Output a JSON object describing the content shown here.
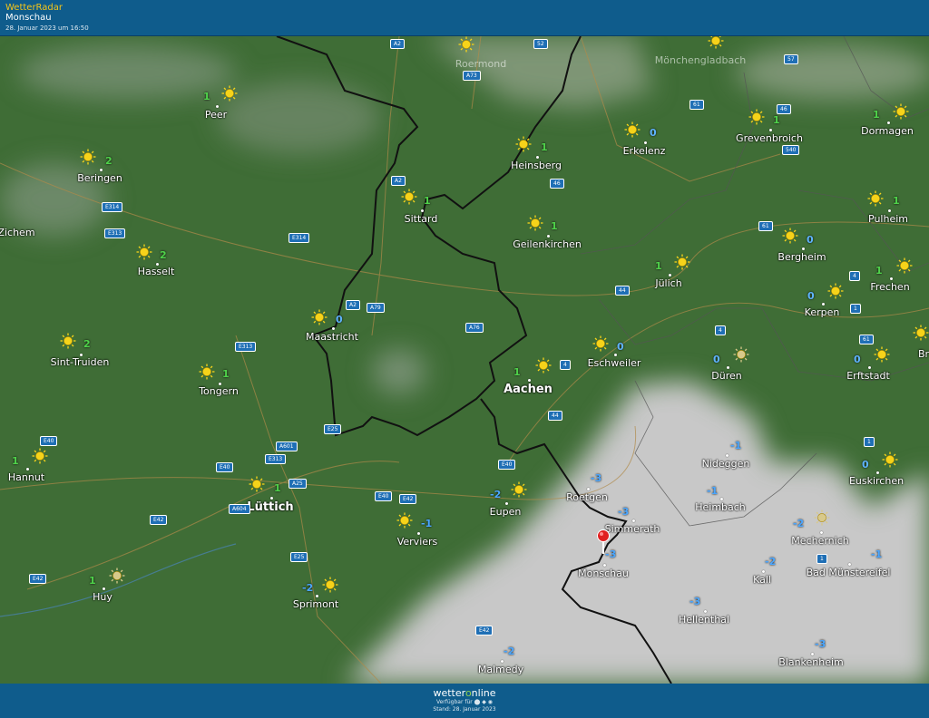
{
  "header": {
    "app_title": "WetterRadar",
    "location": "Monschau",
    "timestamp": "28. Januar 2023 um 16:50"
  },
  "footer": {
    "brand_pre": "wetter",
    "brand_o": "o",
    "brand_post": "nline",
    "available": "Verfügbar für ⬤ ◆ ◉",
    "stand": "Stand: 28. Januar 2023"
  },
  "colors": {
    "header_bg": "#0f5c8c",
    "land": "#3d6a35",
    "cloud": "#c9c9c9",
    "sun": "#f6d31a",
    "positive_temp": "#4fd24a",
    "negative_temp": "#4aa6ff",
    "marker": "#e02020"
  },
  "towns": [
    {
      "name": "Peer",
      "temp": "1",
      "sign": "pos"
    },
    {
      "name": "Beringen",
      "temp": "2",
      "sign": "pos"
    },
    {
      "name": "Zichem",
      "temp": "",
      "sign": "pos"
    },
    {
      "name": "Hasselt",
      "temp": "2",
      "sign": "pos"
    },
    {
      "name": "Sint-Truiden",
      "temp": "2",
      "sign": "pos"
    },
    {
      "name": "Tongern",
      "temp": "1",
      "sign": "pos"
    },
    {
      "name": "Hannut",
      "temp": "1",
      "sign": "pos"
    },
    {
      "name": "Lüttich",
      "temp": "1",
      "sign": "pos"
    },
    {
      "name": "Huy",
      "temp": "1",
      "sign": "pos"
    },
    {
      "name": "Sprimont",
      "temp": "-2",
      "sign": "neg"
    },
    {
      "name": "Verviers",
      "temp": "-1",
      "sign": "neg"
    },
    {
      "name": "Eupen",
      "temp": "-2",
      "sign": "neg"
    },
    {
      "name": "Maastricht",
      "temp": "0",
      "sign": "zero"
    },
    {
      "name": "Sittard",
      "temp": "1",
      "sign": "pos"
    },
    {
      "name": "Heinsberg",
      "temp": "1",
      "sign": "pos"
    },
    {
      "name": "Erkelenz",
      "temp": "0",
      "sign": "zero"
    },
    {
      "name": "Geilenkirchen",
      "temp": "1",
      "sign": "pos"
    },
    {
      "name": "Aachen",
      "temp": "1",
      "sign": "pos"
    },
    {
      "name": "Eschweiler",
      "temp": "0",
      "sign": "zero"
    },
    {
      "name": "Jülich",
      "temp": "1",
      "sign": "pos"
    },
    {
      "name": "Düren",
      "temp": "0",
      "sign": "zero"
    },
    {
      "name": "Grevenbroich",
      "temp": "1",
      "sign": "pos"
    },
    {
      "name": "Dormagen",
      "temp": "1",
      "sign": "pos"
    },
    {
      "name": "Pulheim",
      "temp": "1",
      "sign": "pos"
    },
    {
      "name": "Bergheim",
      "temp": "0",
      "sign": "zero"
    },
    {
      "name": "Frechen",
      "temp": "1",
      "sign": "pos"
    },
    {
      "name": "Kerpen",
      "temp": "0",
      "sign": "zero"
    },
    {
      "name": "Erftstadt",
      "temp": "0",
      "sign": "zero"
    },
    {
      "name": "Br",
      "temp": "",
      "sign": "pos"
    },
    {
      "name": "Euskirchen",
      "temp": "0",
      "sign": "zero"
    },
    {
      "name": "Nideggen",
      "temp": "-1",
      "sign": "neg"
    },
    {
      "name": "Heimbach",
      "temp": "-1",
      "sign": "neg"
    },
    {
      "name": "Mechernich",
      "temp": "-2",
      "sign": "neg"
    },
    {
      "name": "Roetgen",
      "temp": "-3",
      "sign": "neg"
    },
    {
      "name": "Simmerath",
      "temp": "-3",
      "sign": "neg"
    },
    {
      "name": "Monschau",
      "temp": "-3",
      "sign": "neg"
    },
    {
      "name": "Kall",
      "temp": "-2",
      "sign": "neg"
    },
    {
      "name": "Bad Münstereifel",
      "temp": "-1",
      "sign": "neg"
    },
    {
      "name": "Hellenthal",
      "temp": "-3",
      "sign": "neg"
    },
    {
      "name": "Blankenheim",
      "temp": "-3",
      "sign": "neg"
    },
    {
      "name": "Malmedy",
      "temp": "-2",
      "sign": "neg"
    },
    {
      "name": "Roermond",
      "temp": "",
      "sign": "pos"
    },
    {
      "name": "Mönchengladbach",
      "temp": "",
      "sign": "pos"
    }
  ],
  "roads": [
    "A2",
    "52",
    "A73",
    "57",
    "61",
    "46",
    "540",
    "A2",
    "E314",
    "E313",
    "E314",
    "46",
    "61",
    "4",
    "44",
    "A2",
    "A79",
    "A76",
    "E313",
    "4",
    "4",
    "1",
    "61",
    "E25",
    "44",
    "E40",
    "A601",
    "E40",
    "E313",
    "1",
    "A25",
    "E40",
    "E40",
    "E42",
    "A604",
    "E42",
    "E25",
    "E42",
    "1",
    "E42"
  ]
}
